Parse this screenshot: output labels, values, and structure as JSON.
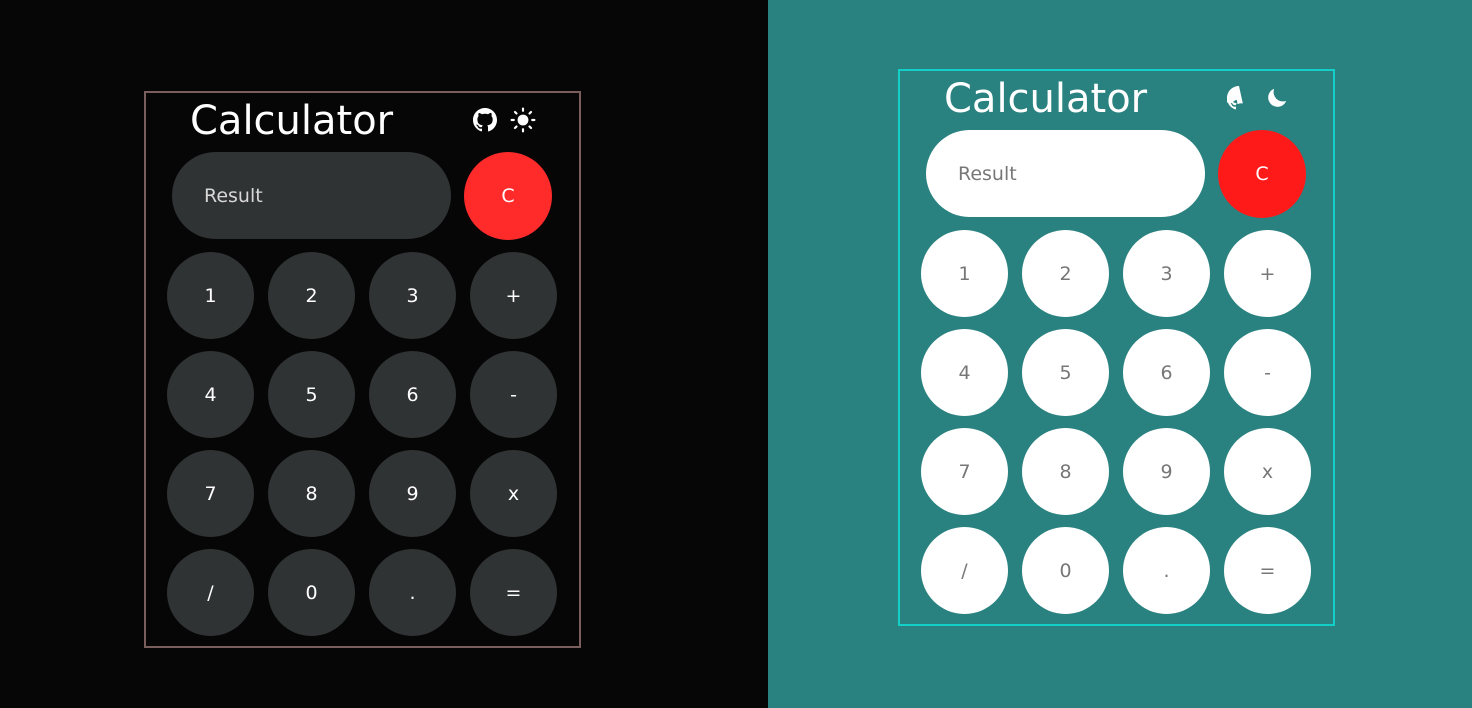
{
  "colors": {
    "dark_background": "#060606",
    "light_background": "#2a8280",
    "dark_border": "#7a5e5e",
    "light_border": "#12cfc8",
    "clear_button": "#ff2a2a",
    "dark_key": "#303333",
    "light_key": "#ffffff"
  },
  "dark": {
    "title": "Calculator",
    "github_icon": "github-icon",
    "theme_icon": "sun-icon",
    "result_placeholder": "Result",
    "clear_label": "C",
    "keys": [
      "1",
      "2",
      "3",
      "+",
      "4",
      "5",
      "6",
      "-",
      "7",
      "8",
      "9",
      "x",
      "/",
      "0",
      ".",
      "="
    ]
  },
  "light": {
    "title": "Calculator",
    "github_icon": "github-icon",
    "theme_icon": "moon-icon",
    "result_placeholder": "Result",
    "clear_label": "C",
    "keys": [
      "1",
      "2",
      "3",
      "+",
      "4",
      "5",
      "6",
      "-",
      "7",
      "8",
      "9",
      "x",
      "/",
      "0",
      ".",
      "="
    ]
  }
}
